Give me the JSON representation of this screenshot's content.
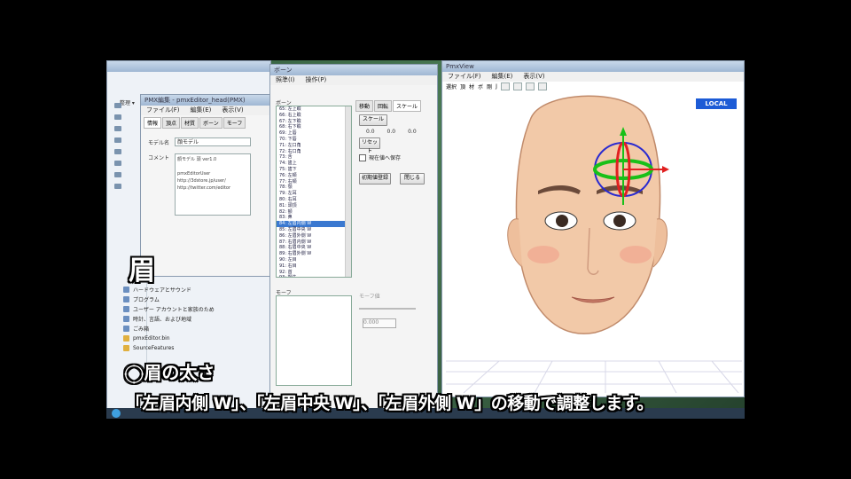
{
  "explorer": {
    "menu_label": "整理 ▾",
    "tree": [
      "ハードウェアとサウンド",
      "プログラム",
      "ユーザー アカウントと家族のため",
      "時計、言語、および地域",
      "ごみ箱",
      "pmxEditor.bin",
      "SourceFeatures"
    ]
  },
  "model_window": {
    "title": "PMX編集 - pmxEditor_head(PMX)",
    "menu": [
      "ファイル(F)",
      "編集(E)",
      "表示(V)"
    ],
    "tabs": [
      "情報",
      "頂点",
      "材質",
      "ボーン",
      "モーフ"
    ],
    "model_name_label": "モデル名",
    "model_name_value": "顔モデル",
    "comment_label": "コメント",
    "comment_value": "顔モデル 頭 ver1.0\n\npmxEditorUser\nhttp://3dstore.jp/user/\nhttp://twitter.com/editor"
  },
  "bone_window": {
    "title": "ボーン",
    "menu": [
      "照準(I)",
      "操作(P)"
    ],
    "list_label": "ボーン",
    "bones": [
      "65: 左上瞼",
      "66: 右上瞼",
      "67: 左下瞼",
      "68: 右下瞼",
      "69: 上唇",
      "70: 下唇",
      "71: 左口角",
      "72: 右口角",
      "73: 舌",
      "74: 歯上",
      "75: 歯下",
      "76: 左頬",
      "77: 右頬",
      "78: 顎",
      "79: 左耳",
      "80: 右耳",
      "81: 頭頂",
      "82: 額",
      "83: 鼻",
      "84: 左眉内側 W",
      "85: 左眉中央 W",
      "86: 左眉外側 W",
      "87: 右眉内側 W",
      "88: 右眉中央 W",
      "89: 右眉外側 W",
      "90: 左目",
      "91: 右目",
      "92: 首",
      "93: 顎先"
    ],
    "selected_index": 19,
    "morph_label": "モーフ",
    "tabs_right": [
      "移動",
      "回転",
      "スケール"
    ],
    "scale_button": "スケール",
    "xyz_values": [
      "0.0",
      "0.0",
      "0.0"
    ],
    "reset_button": "リセット",
    "check_label": "現在値へ保存",
    "register_button": "初期値登録",
    "close_button": "閉じる",
    "slider_label": "モーフ値",
    "slider_value": "0.000"
  },
  "view_window": {
    "title": "PmxView",
    "menu": [
      "ファイル(F)",
      "編集(E)",
      "表示(V)"
    ],
    "toolbar_labels": [
      "選択",
      "頂",
      "材",
      "ボ",
      "剛",
      "J"
    ],
    "axis_chip": "LOCAL"
  },
  "captions": {
    "brow": "眉",
    "thickness": "◯眉の太さ",
    "instruction": "「左眉内側 W」、「左眉中央 W」、「左眉外側 W」の移動で調整します。"
  },
  "colors": {
    "accent": "#1c5bd6",
    "selection": "#3a78d0",
    "gizmo_red": "#e02020",
    "gizmo_green": "#18c018",
    "gizmo_blue": "#2a2ad0"
  },
  "icons": [
    "gizmo-icon",
    "folder-icon"
  ]
}
